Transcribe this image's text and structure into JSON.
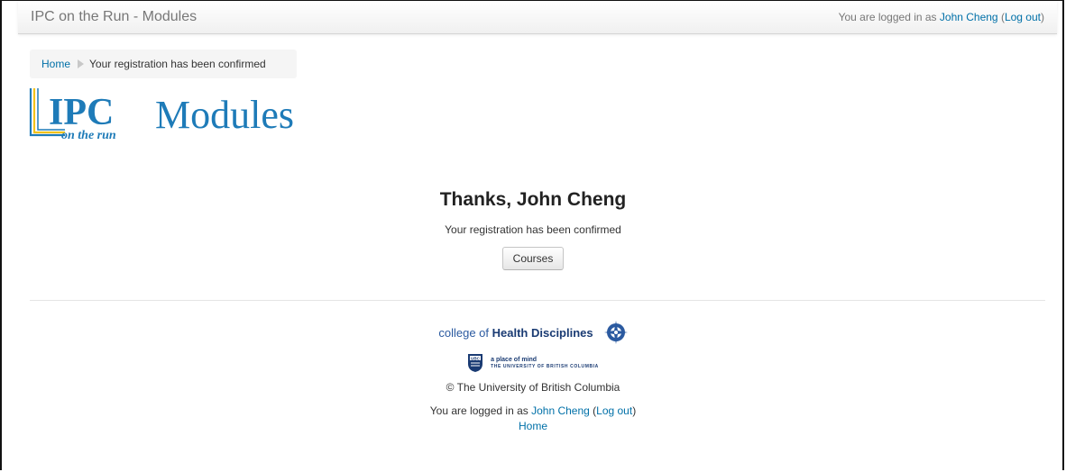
{
  "navbar": {
    "brand": "IPC on the Run - Modules",
    "login_prefix": "You are logged in as ",
    "user_name": "John Cheng",
    "logout_open": " (",
    "logout_label": "Log out",
    "logout_close": ")"
  },
  "breadcrumb": {
    "home": "Home",
    "current": "Your registration has been confirmed"
  },
  "logo": {
    "ipc": "IPC",
    "tagline": "on the run",
    "modules": "Modules"
  },
  "main": {
    "heading": "Thanks, John Cheng",
    "message": "Your registration has been confirmed",
    "courses_button": "Courses"
  },
  "footer": {
    "chd_prefix": "college of ",
    "chd_bold": "Health Disciplines",
    "ubc_crest": "UBC",
    "ubc_line1": "a place of mind",
    "ubc_line2": "THE UNIVERSITY OF BRITISH COLUMBIA",
    "copyright": "© The University of British Columbia",
    "login_prefix": "You are logged in as ",
    "user_name": "John Cheng",
    "logout_open": " (",
    "logout_label": "Log out",
    "logout_close": ")",
    "home": "Home"
  },
  "colors": {
    "link": "#0070a8",
    "logo_blue": "#1e7bb8",
    "logo_yellow": "#f2c21a"
  }
}
